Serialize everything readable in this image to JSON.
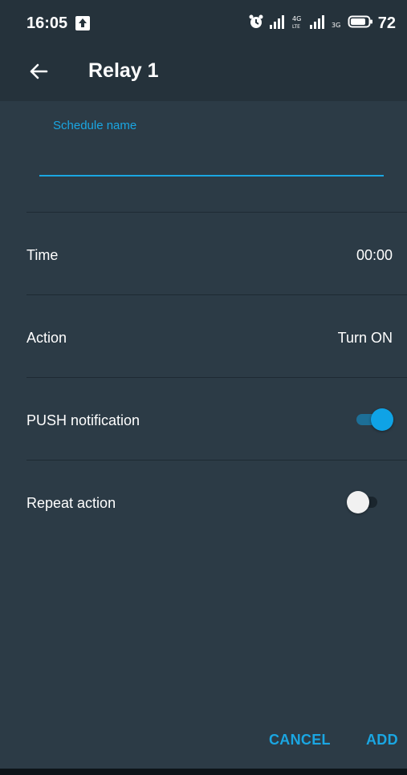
{
  "status_bar": {
    "time": "16:05",
    "battery": "72"
  },
  "app_bar": {
    "title": "Relay 1"
  },
  "form": {
    "schedule_name_label": "Schedule name",
    "schedule_name_value": ""
  },
  "rows": {
    "time": {
      "label": "Time",
      "value": "00:00"
    },
    "action": {
      "label": "Action",
      "value": "Turn ON"
    },
    "push": {
      "label": "PUSH notification",
      "enabled": true
    },
    "repeat": {
      "label": "Repeat action",
      "enabled": false
    }
  },
  "footer": {
    "cancel_label": "CANCEL",
    "add_label": "ADD"
  },
  "colors": {
    "background": "#2c3b46",
    "accent": "#1aa6e2"
  },
  "icons": {
    "back": "arrow-left-icon",
    "alarm": "alarm-clock-icon",
    "signal": "signal-icon",
    "battery": "battery-icon",
    "upload": "upload-icon"
  }
}
